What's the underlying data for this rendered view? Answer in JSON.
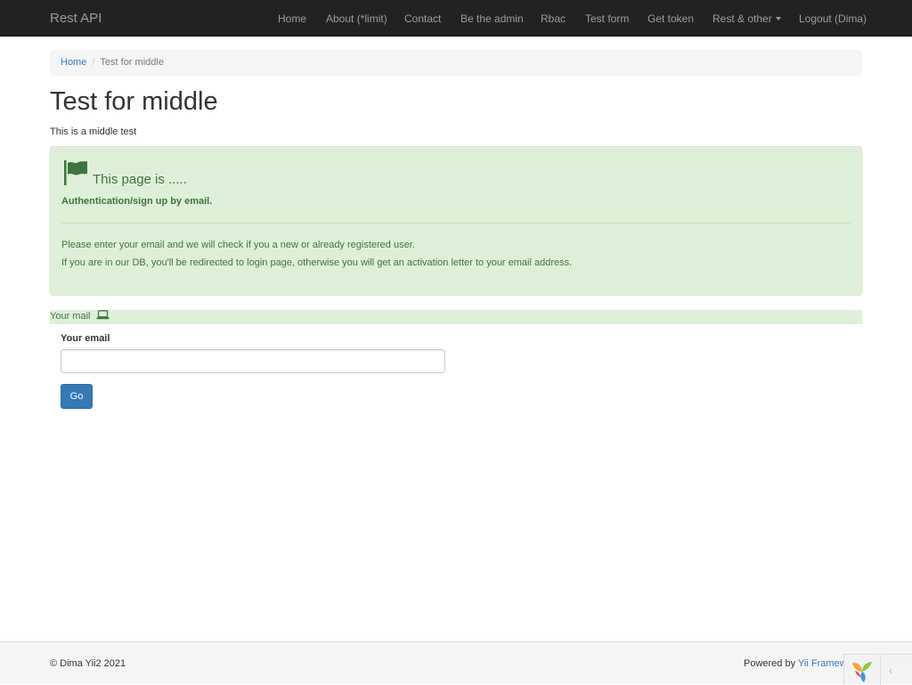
{
  "navbar": {
    "brand": "Rest API",
    "items": [
      {
        "label": "Home"
      },
      {
        "label": "About (*limit)"
      },
      {
        "label": "Contact"
      },
      {
        "label": "Be the admin"
      },
      {
        "label": "Rbac"
      },
      {
        "label": "Test form"
      },
      {
        "label": "Get token"
      },
      {
        "label": "Rest & other",
        "has_dropdown": true
      },
      {
        "label": "Logout (Dima)"
      }
    ]
  },
  "breadcrumb": {
    "home": "Home",
    "separator": "/",
    "current": "Test for middle"
  },
  "page": {
    "title": "Test for middle",
    "intro": "This is a middle test"
  },
  "alert": {
    "icon": "flag-icon",
    "heading": "This page is .....",
    "strong": "Authentication/sign up by email.",
    "line1": "Please enter your email and we will check if you a new or already registered user.",
    "line2": "If you are in our DB, you'll be redirected to login page, otherwise you will get an activation letter to your email address."
  },
  "form": {
    "section_label": "Your mail",
    "section_icon": "laptop-icon",
    "email_label": "Your email",
    "email_value": "",
    "email_placeholder": "",
    "submit_label": "Go"
  },
  "footer": {
    "copyright": "© Dima Yii2 2021",
    "powered_prefix": "Powered by",
    "powered_link": "Yii Framew"
  },
  "debug_toolbar": {
    "logo_icon": "yii-logo-icon",
    "toggle_icon": "chevron-left-icon"
  },
  "colors": {
    "navbar_bg": "#222222",
    "link": "#337ab7",
    "alert_bg": "#dff0d8",
    "alert_text": "#3c763d",
    "primary_button": "#337ab7"
  }
}
